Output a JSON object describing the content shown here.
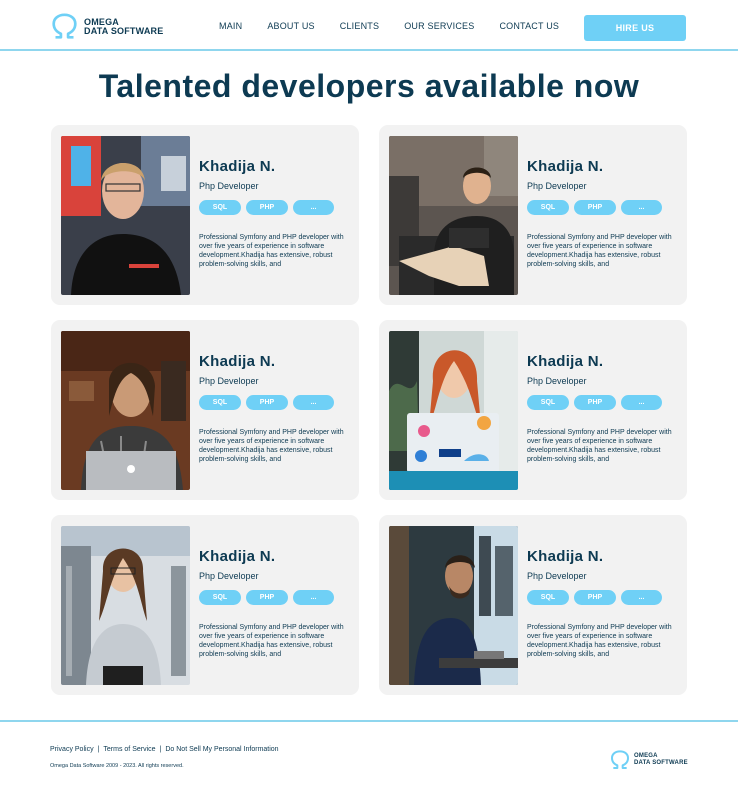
{
  "brand": {
    "line1": "OMEGA",
    "line2": "DATA SOFTWARE",
    "color": "#0d3a52",
    "accent": "#6fd0f6"
  },
  "nav": [
    "MAIN",
    "ABOUT US",
    "CLIENTS",
    "OUR SERVICES",
    "CONTACT US"
  ],
  "header": {
    "cta_label": "HIRE US"
  },
  "page": {
    "title": "Talented developers available now"
  },
  "developers": [
    {
      "name": "Khadija N.",
      "role": "Php Developer",
      "tags": [
        "SQL",
        "PHP",
        "..."
      ],
      "bio": "Professional Symfony and PHP developer with over five years of experience in software development.Khadija has extensive, robust problem-solving skills, and"
    },
    {
      "name": "Khadija N.",
      "role": "Php Developer",
      "tags": [
        "SQL",
        "PHP",
        "..."
      ],
      "bio": "Professional Symfony and PHP developer with over five years of experience in software development.Khadija has extensive, robust problem-solving skills, and"
    },
    {
      "name": "Khadija N.",
      "role": "Php Developer",
      "tags": [
        "SQL",
        "PHP",
        "..."
      ],
      "bio": "Professional Symfony and PHP developer with over five years of experience in software development.Khadija has extensive, robust problem-solving skills, and"
    },
    {
      "name": "Khadija N.",
      "role": "Php Developer",
      "tags": [
        "SQL",
        "PHP",
        "..."
      ],
      "bio": "Professional Symfony and PHP developer with over five years of experience in software development.Khadija has extensive, robust problem-solving skills, and"
    },
    {
      "name": "Khadija N.",
      "role": "Php Developer",
      "tags": [
        "SQL",
        "PHP",
        "..."
      ],
      "bio": "Professional Symfony and PHP developer with over five years of experience in software development.Khadija has extensive, robust problem-solving skills, and"
    },
    {
      "name": "Khadija N.",
      "role": "Php Developer",
      "tags": [
        "SQL",
        "PHP",
        "..."
      ],
      "bio": "Professional Symfony and PHP developer with over five years of experience in software development.Khadija has extensive, robust problem-solving skills, and"
    }
  ],
  "footer": {
    "links": [
      "Privacy Policy",
      "Terms of Service",
      "Do Not Sell My Personal Information"
    ],
    "separator": "|",
    "copyright": "Omega Data Software 2009 - 2023. All rights reserved."
  }
}
